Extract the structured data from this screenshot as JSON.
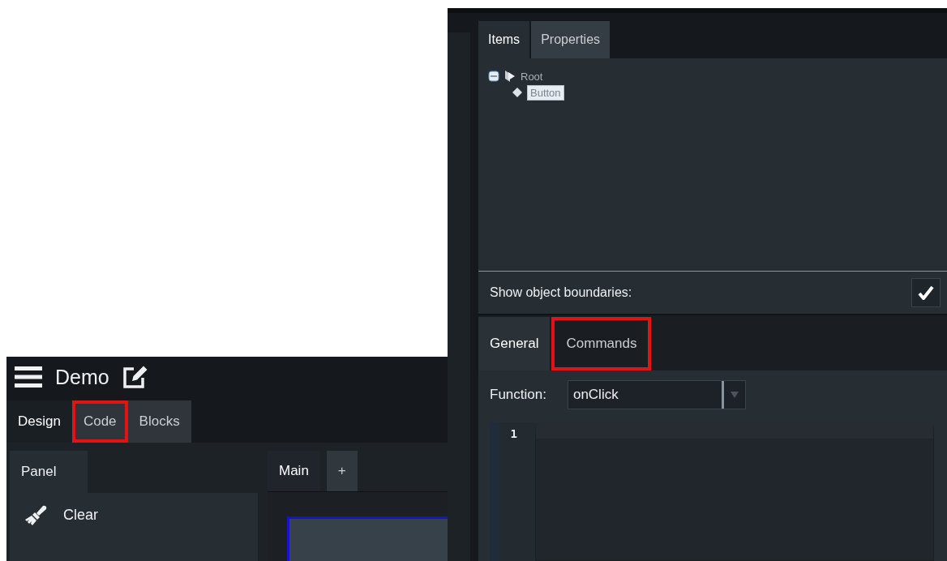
{
  "left_window": {
    "title": "Demo",
    "mode_tabs": [
      {
        "label": "Design",
        "selected": true,
        "highlighted": false
      },
      {
        "label": "Code",
        "selected": false,
        "highlighted": true
      },
      {
        "label": "Blocks",
        "selected": false,
        "highlighted": false
      }
    ],
    "panel_tabs": [
      {
        "label": "Panel",
        "selected": true
      }
    ],
    "panel_items": [
      {
        "label": "Clear"
      }
    ],
    "canvas_tabs": [
      {
        "label": "Main",
        "selected": true
      },
      {
        "label": "+",
        "selected": false
      }
    ]
  },
  "right_window": {
    "top_tabs": [
      {
        "label": "Items",
        "selected": true,
        "highlighted": false
      },
      {
        "label": "Properties",
        "selected": false,
        "highlighted": false
      }
    ],
    "tree": [
      {
        "label": "Root",
        "expanded": true,
        "selected": false,
        "children": [
          {
            "label": "Button",
            "selected": true
          }
        ]
      }
    ],
    "show_boundaries": {
      "label": "Show object boundaries:",
      "checked": true
    },
    "bottom_tabs": [
      {
        "label": "General",
        "selected": true,
        "highlighted": false
      },
      {
        "label": "Commands",
        "selected": false,
        "highlighted": true
      }
    ],
    "function": {
      "label": "Function:",
      "value": "onClick"
    },
    "editor": {
      "line_numbers": [
        "1"
      ]
    }
  }
}
